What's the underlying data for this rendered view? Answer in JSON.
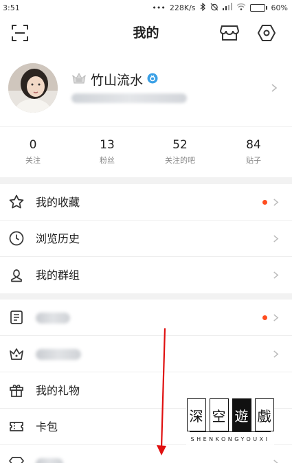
{
  "status_bar": {
    "time": "3:51",
    "dots": "•••",
    "net_speed": "228K/s",
    "battery_pct": "60%",
    "battery_level": 0.6
  },
  "header": {
    "title": "我的",
    "left_icon": "scan-icon",
    "right_icons": [
      "shop-icon",
      "settings-hex-icon"
    ]
  },
  "profile": {
    "username": "竹山流水",
    "badge_icon": "crown-icon",
    "verified_icon": "verified-badge-icon"
  },
  "stats": [
    {
      "value": "0",
      "label": "关注"
    },
    {
      "value": "13",
      "label": "粉丝"
    },
    {
      "value": "52",
      "label": "关注的吧"
    },
    {
      "value": "84",
      "label": "贴子"
    }
  ],
  "menu_group_1": [
    {
      "label": "我的收藏",
      "icon": "star-icon",
      "has_dot": true
    },
    {
      "label": "浏览历史",
      "icon": "clock-icon",
      "has_dot": false
    },
    {
      "label": "我的群组",
      "icon": "person-icon",
      "has_dot": false
    }
  ],
  "menu_group_2": [
    {
      "label": "",
      "icon": "book-icon",
      "has_dot": true
    },
    {
      "label": "",
      "icon": "crown-outline-icon",
      "has_dot": false
    },
    {
      "label": "我的礼物",
      "icon": "gift-icon",
      "has_dot": false
    },
    {
      "label": "卡包",
      "icon": "ticket-icon",
      "has_dot": false
    },
    {
      "label": "",
      "icon": "diamond-icon",
      "has_dot": false
    }
  ],
  "watermark": {
    "chars": [
      "深",
      "空",
      "遊",
      "戲"
    ],
    "text": "SHENKONGYOUXI"
  },
  "colors": {
    "accent_dot": "#ff4d1f",
    "verified": "#3aa0e6",
    "arrow": "#e01010"
  }
}
